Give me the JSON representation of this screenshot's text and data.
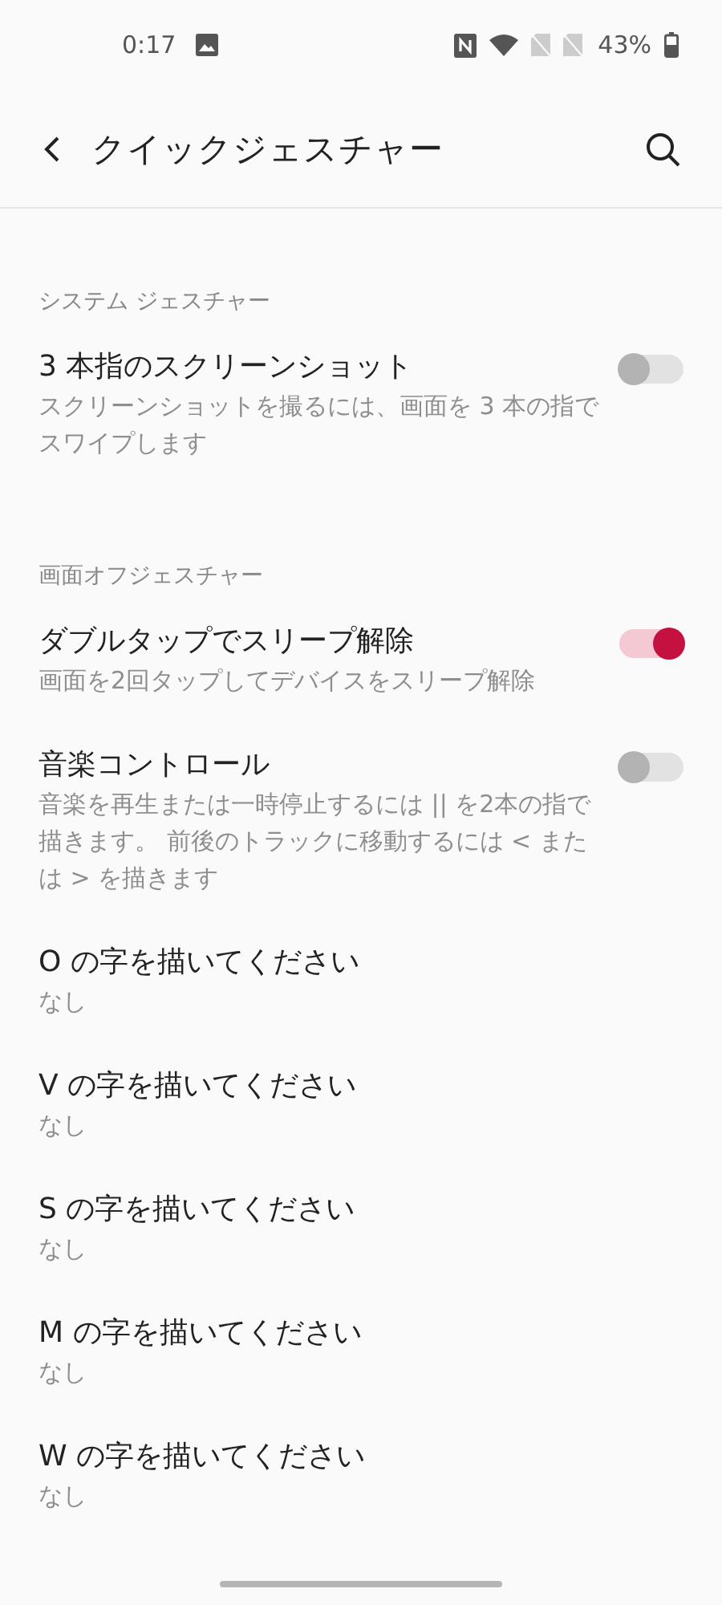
{
  "status_bar": {
    "time": "0:17",
    "battery": "43%"
  },
  "header": {
    "title": "クイックジェスチャー"
  },
  "sections": [
    {
      "title": "システム ジェスチャー",
      "items": [
        {
          "kind": "switch",
          "title": "3 本指のスクリーンショット",
          "summary": "スクリーンショットを撮るには、画面を 3 本の指でスワイプします",
          "on": false
        }
      ]
    },
    {
      "title": "画面オフジェスチャー",
      "items": [
        {
          "kind": "switch",
          "title": "ダブルタップでスリープ解除",
          "summary": "画面を2回タップしてデバイスをスリープ解除",
          "on": true
        },
        {
          "kind": "switch",
          "title": "音楽コントロール",
          "summary": "音楽を再生または一時停止するには || を2本の指で描きます。 前後のトラックに移動するには < または > を描きます",
          "on": false
        },
        {
          "kind": "value",
          "title": "O の字を描いてください",
          "summary": "なし"
        },
        {
          "kind": "value",
          "title": "V の字を描いてください",
          "summary": "なし"
        },
        {
          "kind": "value",
          "title": "S の字を描いてください",
          "summary": "なし"
        },
        {
          "kind": "value",
          "title": "M の字を描いてください",
          "summary": "なし"
        },
        {
          "kind": "value",
          "title": "W の字を描いてください",
          "summary": "なし"
        }
      ]
    }
  ]
}
